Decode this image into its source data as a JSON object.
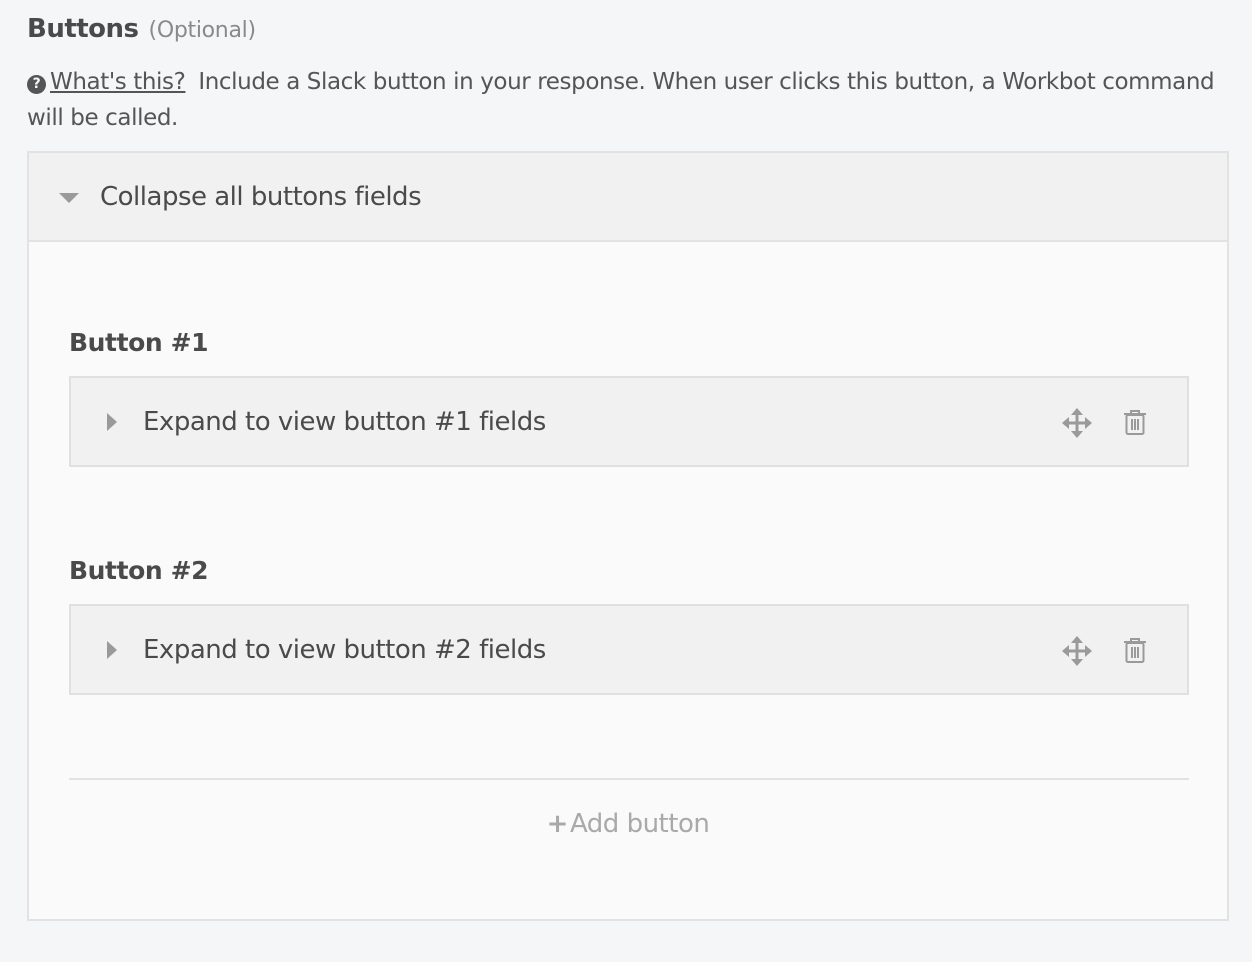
{
  "field": {
    "title": "Buttons",
    "optional_label": "(Optional)",
    "help_link": "What's this?",
    "help_text": "Include a Slack button in your response. When user clicks this button, a Workbot command will be called."
  },
  "panel": {
    "collapse_label": "Collapse all buttons fields",
    "buttons": [
      {
        "title": "Button #1",
        "expand_label": "Expand to view button #1 fields"
      },
      {
        "title": "Button #2",
        "expand_label": "Expand to view button #2 fields"
      }
    ],
    "add_label": "Add button"
  },
  "colors": {
    "icon_gray": "#9a9a9a",
    "muted_text": "#a9a9a9",
    "border": "#e2e2e2"
  }
}
